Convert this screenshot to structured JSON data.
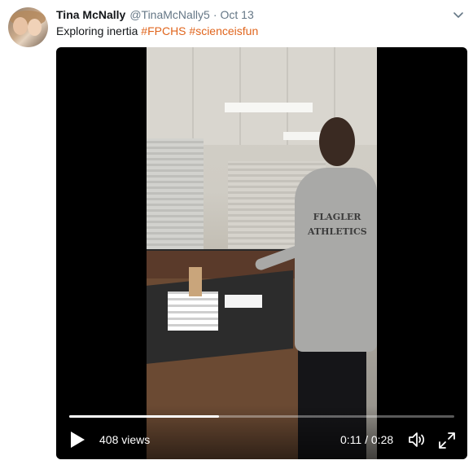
{
  "tweet": {
    "name": "Tina McNally",
    "handle": "@TinaMcNally5",
    "separator": "·",
    "date": "Oct 13",
    "text_prefix": "Exploring inertia ",
    "hashtags": [
      "#FPCHS",
      "#scienceisfun"
    ],
    "hashtag_color": "#e0651d"
  },
  "icons": {
    "caret": "chevron-down-icon",
    "play": "play-icon",
    "volume": "volume-icon",
    "fullscreen": "fullscreen-icon"
  },
  "video": {
    "views": "408 views",
    "current_time": "0:11",
    "time_separator": " / ",
    "duration": "0:28",
    "progress": 0.39,
    "shirt_text_line1": "FLAGLER",
    "shirt_text_line2": "ATHLETICS"
  }
}
